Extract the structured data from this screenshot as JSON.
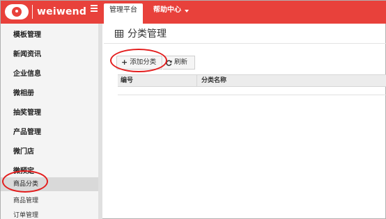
{
  "app": {
    "logo_text": "weiwend"
  },
  "topnav": {
    "tabs": [
      {
        "label": "管理平台"
      },
      {
        "label": "帮助中心"
      }
    ]
  },
  "sidebar": {
    "items": [
      {
        "label": "模板管理"
      },
      {
        "label": "新闻资讯"
      },
      {
        "label": "企业信息"
      },
      {
        "label": "微相册"
      },
      {
        "label": "抽奖管理"
      },
      {
        "label": "产品管理"
      },
      {
        "label": "微门店"
      },
      {
        "label": "微预定"
      }
    ],
    "subitems": [
      {
        "label": "商品分类"
      },
      {
        "label": "商品管理"
      },
      {
        "label": "订单管理"
      }
    ]
  },
  "main": {
    "title": "分类管理",
    "toolbar": {
      "add_label": "添加分类",
      "refresh_label": "刷新"
    },
    "table": {
      "columns": [
        "编号",
        "分类名称"
      ]
    }
  },
  "colors": {
    "brand": "#e8413b",
    "highlight": "#e31d1d"
  },
  "icons": [
    "menu-icon",
    "grid-table-icon",
    "plus-icon",
    "refresh-icon",
    "caret-down-icon"
  ]
}
